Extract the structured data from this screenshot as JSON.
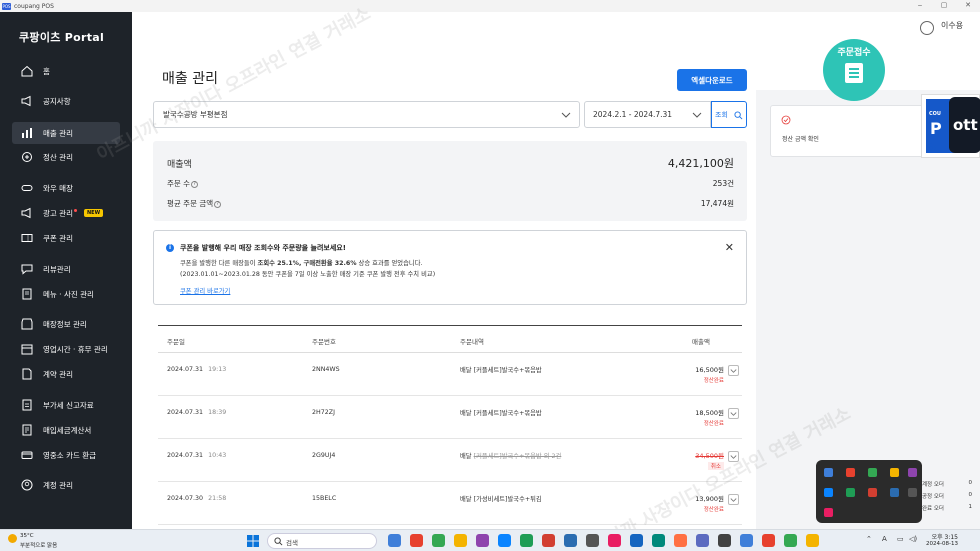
{
  "window": {
    "title": "coupang POS",
    "icon_text": "POS",
    "controls": [
      "‒",
      "▢",
      "✕"
    ]
  },
  "sidebar": {
    "brand": "쿠팡이츠 Portal",
    "items": [
      {
        "label": "홈",
        "icon": "home-icon"
      },
      {
        "label": "공지사항",
        "icon": "megaphone-icon"
      },
      {
        "label": "매출 관리",
        "icon": "bar-chart-icon",
        "active": true
      },
      {
        "label": "정산 관리",
        "icon": "settlement-icon"
      },
      {
        "label": "와우 매장",
        "icon": "wow-store-icon"
      },
      {
        "label": "광고 관리",
        "icon": "ad-icon",
        "badge": "NEW"
      },
      {
        "label": "쿠폰 관리",
        "icon": "coupon-icon"
      },
      {
        "label": "리뷰관리",
        "icon": "review-icon"
      },
      {
        "label": "메뉴 · 사진 관리",
        "icon": "menu-book-icon"
      },
      {
        "label": "매장정보 관리",
        "icon": "store-icon"
      },
      {
        "label": "영업시간 · 휴무 관리",
        "icon": "calendar-icon"
      },
      {
        "label": "계약 관리",
        "icon": "contract-icon"
      },
      {
        "label": "부가세 신고자료",
        "icon": "tax-report-icon"
      },
      {
        "label": "매입세금계산서",
        "icon": "invoice-icon"
      },
      {
        "label": "영중소 카드 환급",
        "icon": "card-icon"
      },
      {
        "label": "계정 관리",
        "icon": "account-icon"
      }
    ]
  },
  "header": {
    "user_name": "이수용"
  },
  "main": {
    "title": "매출 관리",
    "excel_button": "엑셀다운로드",
    "store_select": "발국수공방 부평본점",
    "date_range": "2024.2.1 - 2024.7.31",
    "query_button": "조회",
    "summary": {
      "sales_label": "매출액",
      "sales_value": "4,421,100원",
      "orders_label": "주문 수",
      "orders_value": "253건",
      "avg_label": "평균 주문 금액",
      "avg_value": "17,474원"
    },
    "notice": {
      "title": "쿠폰을 발행해 우리 매장 조회수와 주문량을 늘려보세요!",
      "line1_a": "쿠폰을 발행한 다른 매장들이 ",
      "line1_b": "조회수 25.1%, 구매전환율 32.6%",
      "line1_c": " 상승 효과를 얻었습니다.",
      "line2": "(2023.01.01~2023.01.28 동안 쿠폰을 7일 이상 노출한 매장 기준 쿠폰 발행 전후 수치 비교)",
      "link": "쿠폰 관리 바로가기",
      "close": "✕"
    },
    "table": {
      "headers": [
        "주문일",
        "주문번호",
        "주문내역",
        "매출액"
      ],
      "rows": [
        {
          "date": "2024.07.31",
          "time": "19:13",
          "order_no": "2NN4WS",
          "type": "배달",
          "detail": "[커플세트]발국수+볶음밥",
          "amount": "16,500원",
          "status": "정산완료",
          "cancelled": false
        },
        {
          "date": "2024.07.31",
          "time": "18:39",
          "order_no": "2H72ZJ",
          "type": "배달",
          "detail": "[커플세트]발국수+볶음밥",
          "amount": "18,500원",
          "status": "정산완료",
          "cancelled": false
        },
        {
          "date": "2024.07.31",
          "time": "10:43",
          "order_no": "2G9UJ4",
          "type": "배달",
          "detail": "[커플세트]발국수+볶음밥 외 2건",
          "amount": "34,500원",
          "status": "취소",
          "cancelled": true
        },
        {
          "date": "2024.07.30",
          "time": "21:58",
          "order_no": "15BELC",
          "type": "배달",
          "detail": "[가성비세트]발국수+튀김",
          "amount": "13,900원",
          "status": "정산완료",
          "cancelled": false
        }
      ]
    }
  },
  "right_panel": {
    "card_text": "정산 금액 확인",
    "order_fab": "주문접수",
    "pos_c": "COU",
    "pos_p": "P",
    "pos_dark": "ott"
  },
  "side_status": [
    {
      "label": "계정 오더",
      "value": "0"
    },
    {
      "label": "공정 오더",
      "value": "0"
    },
    {
      "label": "완료 오더",
      "value": "1"
    }
  ],
  "watermark": "아프니까 사장이다 오프라인 연결 거래소",
  "taskbar": {
    "weather_temp": "35°C",
    "weather_desc": "부분적으로 맑음",
    "search_placeholder": "검색",
    "clock_time": "오후 3:15",
    "clock_date": "2024-08-13",
    "ime": "A",
    "colors": [
      "#3f7fd9",
      "#e7412e",
      "#34a853",
      "#f4b400",
      "#8e44ad",
      "#0a84ff",
      "#1f9d55",
      "#d23f31",
      "#2b6cb0",
      "#555555",
      "#e91e63",
      "#1565c0",
      "#00897b",
      "#ff7043",
      "#5c6bc0",
      "#424242"
    ]
  }
}
